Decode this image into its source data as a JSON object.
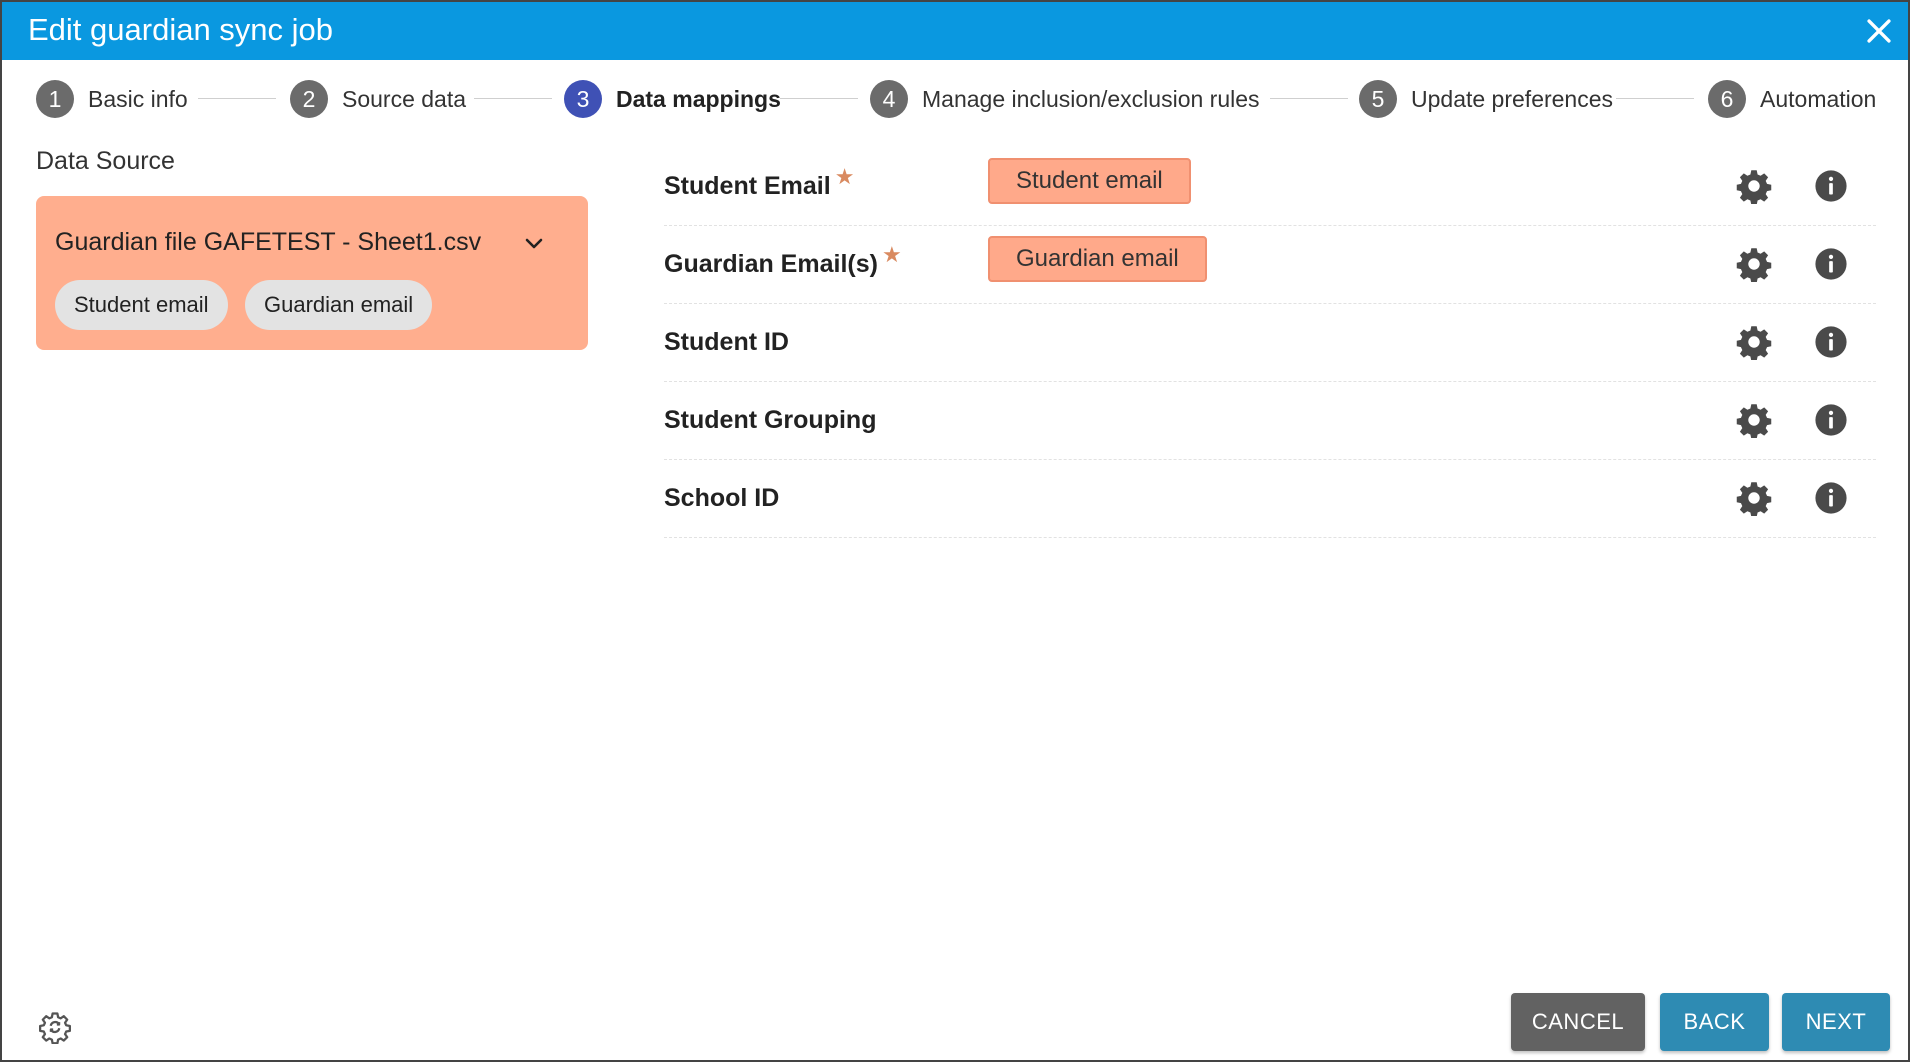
{
  "dialog": {
    "title": "Edit guardian sync job"
  },
  "stepper": {
    "steps": [
      {
        "number": "1",
        "label": "Basic info"
      },
      {
        "number": "2",
        "label": "Source data"
      },
      {
        "number": "3",
        "label": "Data mappings",
        "active": true
      },
      {
        "number": "4",
        "label": "Manage inclusion/exclusion rules"
      },
      {
        "number": "5",
        "label": "Update preferences"
      },
      {
        "number": "6",
        "label": "Automation"
      }
    ]
  },
  "data_source": {
    "title": "Data Source",
    "file_name": "Guardian file GAFETEST - Sheet1.csv",
    "columns": [
      "Student email",
      "Guardian email"
    ]
  },
  "mappings": {
    "rows": [
      {
        "label": "Student Email",
        "required_marker": "★",
        "mapped_value": "Student email"
      },
      {
        "label": "Guardian Email(s)",
        "required_marker": "★",
        "mapped_value": "Guardian email"
      },
      {
        "label": "Student ID"
      },
      {
        "label": "Student Grouping"
      },
      {
        "label": "School ID"
      }
    ]
  },
  "footer": {
    "cancel_label": "CANCEL",
    "back_label": "BACK",
    "next_label": "NEXT"
  },
  "colors": {
    "title_bar": "#0a98e0",
    "active_step": "#3f51b5",
    "source_card": "#ffae8e",
    "mapped_chip": "#ffa98a",
    "cancel_button": "#626262",
    "nav_button": "#2e8bb3"
  },
  "icons": {
    "close": "close-icon",
    "chevron": "chevron-down-icon",
    "row_settings": "gear-icon",
    "row_info": "info-icon",
    "footer_settings": "settings-sync-icon"
  }
}
